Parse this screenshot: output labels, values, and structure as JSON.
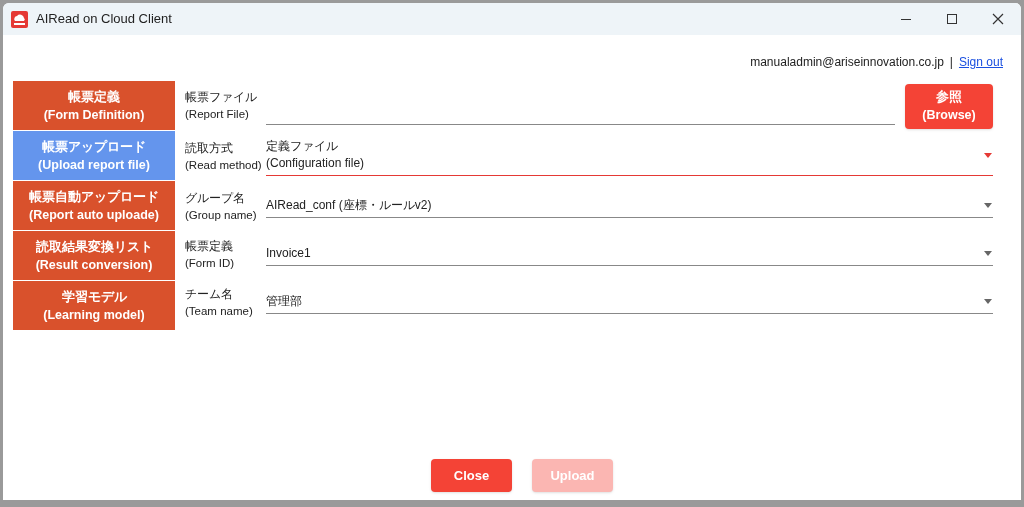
{
  "window": {
    "title": "AIRead on Cloud Client"
  },
  "account": {
    "email": "manualadmin@ariseinnovation.co.jp",
    "separator": "|",
    "sign_out": "Sign out"
  },
  "sidebar": {
    "items": [
      {
        "label": "帳票定義",
        "sublabel": "(Form Definition)",
        "selected": false
      },
      {
        "label": "帳票アップロード",
        "sublabel": "(Upload report file)",
        "selected": true
      },
      {
        "label": "帳票自動アップロード",
        "sublabel": "(Report auto uploade)",
        "selected": false
      },
      {
        "label": "読取結果変換リスト",
        "sublabel": "(Result conversion)",
        "selected": false
      },
      {
        "label": "学習モデル",
        "sublabel": "(Learning model)",
        "selected": false
      }
    ]
  },
  "fields": [
    {
      "kind": "file",
      "label": "帳票ファイル",
      "sublabel": "(Report File)",
      "button": {
        "label": "参照",
        "sublabel": "(Browse)"
      }
    },
    {
      "kind": "select",
      "label": "読取方式",
      "sublabel": "(Read method)",
      "value": "定義ファイル",
      "value_line2": "(Configuration file)",
      "focused": true
    },
    {
      "kind": "select",
      "label": "グループ名",
      "sublabel": "(Group name)",
      "value": "AIRead_conf (座標・ルールv2)",
      "focused": false
    },
    {
      "kind": "select",
      "label": "帳票定義",
      "sublabel": "(Form ID)",
      "value": "Invoice1",
      "focused": false
    },
    {
      "kind": "select",
      "label": "チーム名",
      "sublabel": "(Team name)",
      "value": "管理部",
      "focused": false
    }
  ],
  "buttons": [
    {
      "label": "Close",
      "disabled": false
    },
    {
      "label": "Upload",
      "disabled": true
    }
  ]
}
